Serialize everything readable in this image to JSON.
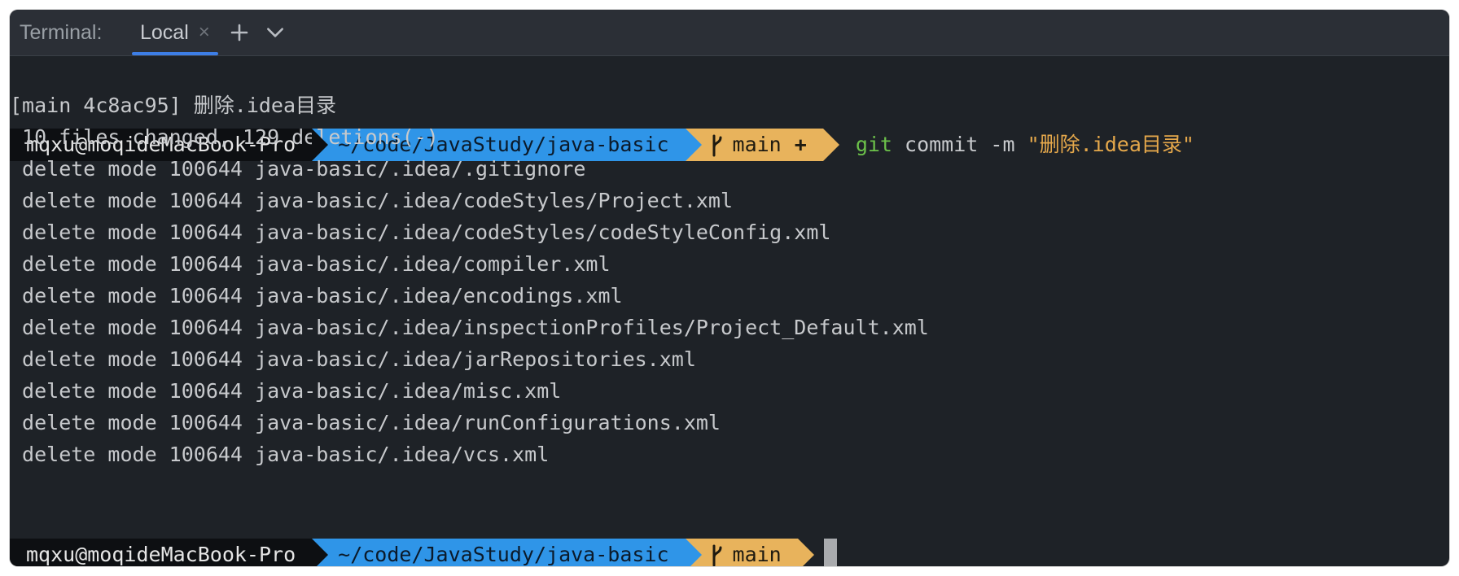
{
  "tabbar": {
    "title": "Terminal:",
    "tab_label": "Local",
    "tab_close": "×",
    "add_icon": "plus-icon",
    "menu_icon": "chevron-down-icon"
  },
  "prompt": {
    "user": "mqxu@moqideMacBook-Pro",
    "path": "~/code/JavaStudy/java-basic",
    "branch": "main",
    "dirty_mark": "+"
  },
  "command": {
    "git": "git",
    "args": "commit -m",
    "message": "\"删除.idea目录\""
  },
  "output": [
    "[main 4c8ac95] 删除.idea目录",
    " 10 files changed, 129 deletions(-)",
    " delete mode 100644 java-basic/.idea/.gitignore",
    " delete mode 100644 java-basic/.idea/codeStyles/Project.xml",
    " delete mode 100644 java-basic/.idea/codeStyles/codeStyleConfig.xml",
    " delete mode 100644 java-basic/.idea/compiler.xml",
    " delete mode 100644 java-basic/.idea/encodings.xml",
    " delete mode 100644 java-basic/.idea/inspectionProfiles/Project_Default.xml",
    " delete mode 100644 java-basic/.idea/jarRepositories.xml",
    " delete mode 100644 java-basic/.idea/misc.xml",
    " delete mode 100644 java-basic/.idea/runConfigurations.xml",
    " delete mode 100644 java-basic/.idea/vcs.xml"
  ],
  "colors": {
    "background": "#1e2227",
    "user_segment": "#0d0f12",
    "path_segment": "#2f95e8",
    "git_segment": "#e8b35c",
    "git_command": "#6cc24a",
    "string": "#e5a84b",
    "tab_accent": "#3d7ee6"
  }
}
